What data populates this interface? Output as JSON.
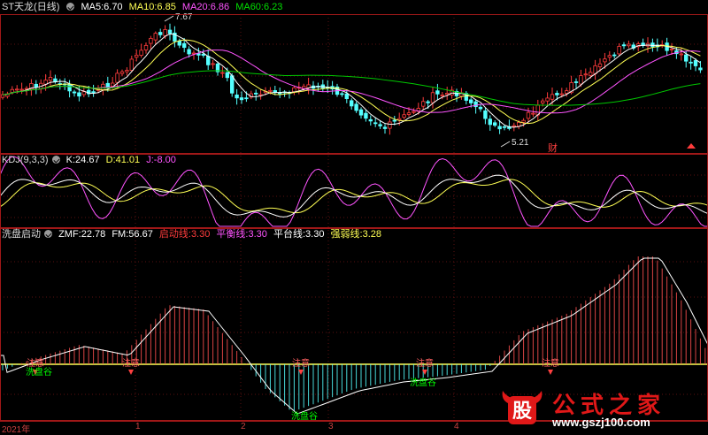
{
  "colors": {
    "background": "#000000",
    "panel_border": "#a01818",
    "grid": "#5a1010",
    "up": "#ff3c3c",
    "down": "#54ffff",
    "ma5": "#ffffff",
    "ma10": "#ffff54",
    "ma20": "#ff54ff",
    "ma60": "#00c800",
    "kdj_k": "#ffffff",
    "kdj_d": "#ffff54",
    "kdj_j": "#ff54ff",
    "zmf": "#ffffff",
    "start_line": "#ff3c3c",
    "balance_line": "#ff54ff",
    "platform_line": "#ffffff",
    "strong_weak_line": "#ffff54",
    "signal_label": "#00ff00",
    "accent_label": "#ff4040"
  },
  "main_panel": {
    "title": "ST天龙(日线)",
    "ma5": {
      "label": "MA5:",
      "value": "6.70"
    },
    "ma10": {
      "label": "MA10:",
      "value": "6.85"
    },
    "ma20": {
      "label": "MA20:",
      "value": "6.86"
    },
    "ma60": {
      "label": "MA60:",
      "value": "6.23"
    },
    "high_label": "7.67",
    "low_label": "5.21",
    "finance_badge": "财"
  },
  "kdj_panel": {
    "title": "KDJ(9,3,3)",
    "k": {
      "label": "K:",
      "value": "24.67"
    },
    "d": {
      "label": "D:",
      "value": "41.01"
    },
    "j": {
      "label": "J:",
      "value": "-8.00"
    }
  },
  "wash_panel": {
    "title": "洗盘启动",
    "zmf": {
      "label": "ZMF:",
      "value": "22.78"
    },
    "fm": {
      "label": "FM:",
      "value": "56.67"
    },
    "start": {
      "label": "启动线:",
      "value": "3.30"
    },
    "balance": {
      "label": "平衡线:",
      "value": "3.30"
    },
    "platform": {
      "label": "平台线:",
      "value": "3.30"
    },
    "strong": {
      "label": "强弱线:",
      "value": "3.28"
    },
    "signal_zhuyi": "注意",
    "signal_xipan": "洗盘谷"
  },
  "x_axis": {
    "labels": [
      "2021年",
      "1",
      "2",
      "3",
      "4"
    ]
  },
  "watermark": {
    "mark": "股",
    "text": "公式之家",
    "url": "www.gszj100.com"
  }
}
